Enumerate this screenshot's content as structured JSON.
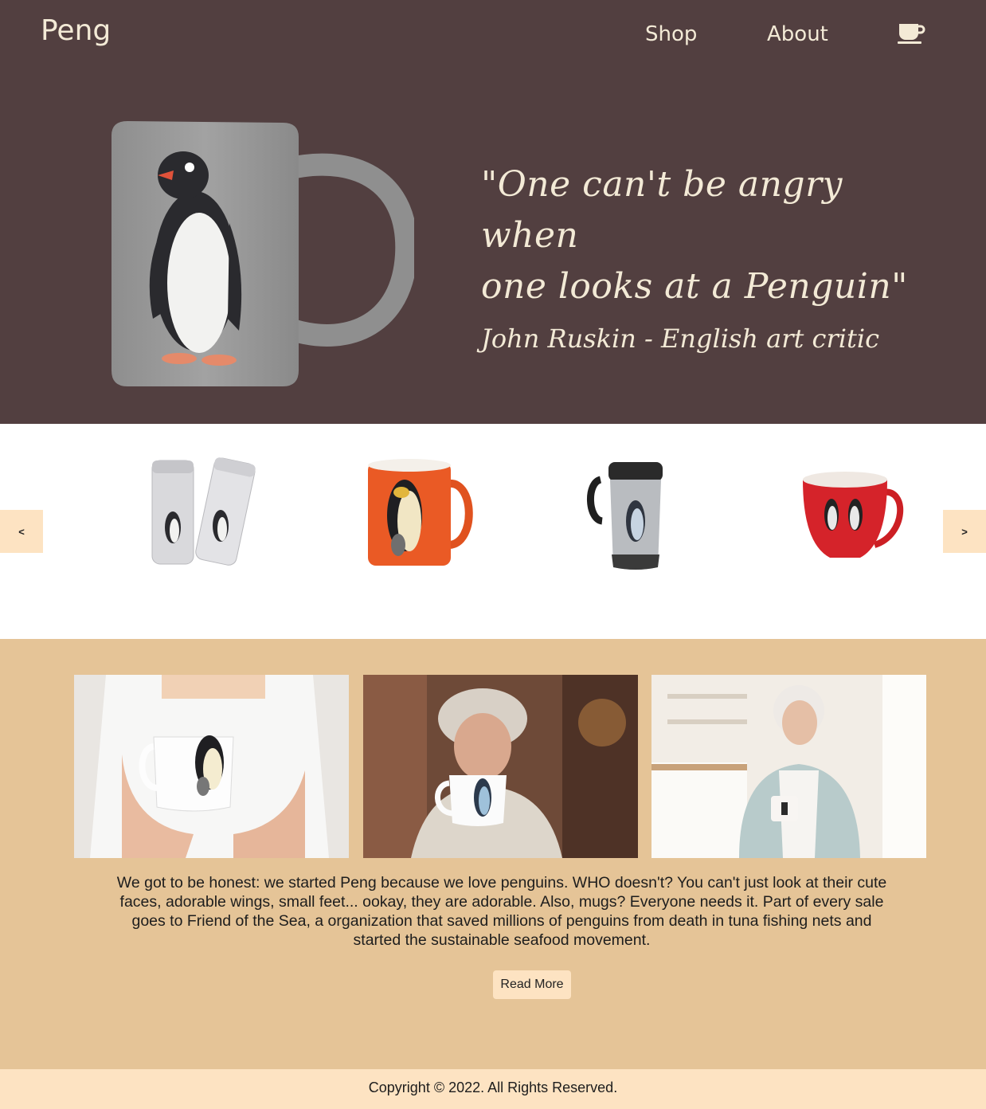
{
  "brand": {
    "name": "Peng"
  },
  "nav": {
    "items": [
      {
        "label": "Shop"
      },
      {
        "label": "About"
      }
    ],
    "cart_icon": "coffee-cup-icon"
  },
  "hero": {
    "image": "penguin-mug-image",
    "quote_line1": "\"One can't be angry when",
    "quote_line2": "one looks at a Penguin\"",
    "author": "John Ruskin - English art critic"
  },
  "carousel": {
    "prev_label": "<",
    "next_label": ">",
    "products": [
      {
        "icon": "penguin-travel-tumblers-image"
      },
      {
        "icon": "orange-penguin-mug-image"
      },
      {
        "icon": "steel-travel-mug-image"
      },
      {
        "icon": "red-penguin-mug-image"
      }
    ]
  },
  "about": {
    "photos": [
      {
        "icon": "woman-holding-mug-photo"
      },
      {
        "icon": "woman-forest-mug-photo"
      },
      {
        "icon": "senior-woman-mug-photo"
      }
    ],
    "text": "We got to be honest: we started Peng because we love penguins. WHO doesn't? You can't just look at their cute faces, adorable wings, small feet... ookay, they are adorable. Also, mugs? Everyone needs it. Part of every sale goes to Friend of the Sea, a organization that saved millions of penguins from death in tuna fishing nets and started the sustainable seafood movement.",
    "button_label": "Read More"
  },
  "footer": {
    "copyright": "Copyright © 2022. All Rights Reserved."
  },
  "colors": {
    "hero_bg": "#523f40",
    "about_bg": "#e5c497",
    "accent_light": "#fde3c2",
    "cream_text": "#f3ead6"
  }
}
